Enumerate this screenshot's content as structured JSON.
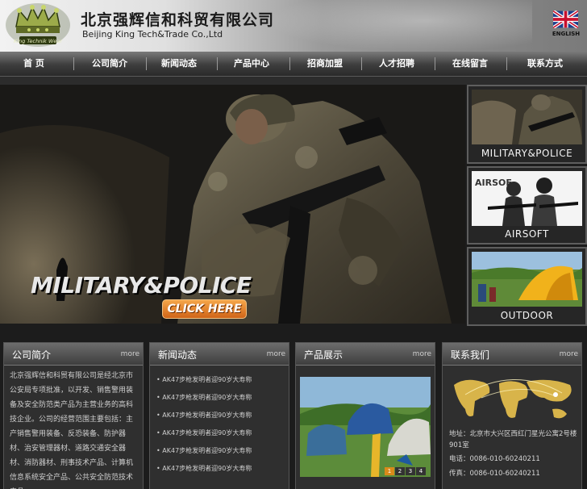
{
  "header": {
    "company_cn": "北京强辉信和科贸有限公司",
    "company_en": "Beijing King Tech&Trade Co.,Ltd",
    "logo_text": "King Technik Wear",
    "english_label": "ENGLISH"
  },
  "nav": {
    "items": [
      "首 页",
      "公司简介",
      "新闻动态",
      "产品中心",
      "招商加盟",
      "人才招聘",
      "在线留言",
      "联系方式"
    ]
  },
  "banner": {
    "title": "MILITARY&POLICE",
    "button": "CLICK HERE"
  },
  "side_thumbs": [
    {
      "label": "MILITARY&POLICE"
    },
    {
      "label": "AIRSOFT",
      "logo_text": "AIRSOF"
    },
    {
      "label": "OUTDOOR"
    }
  ],
  "about": {
    "title": "公司简介",
    "more": "more",
    "text": "北京强辉信和科贸有限公司是经北京市公安局专项批准，以开发、销售警用装备及安全防范类产品为主营业务的高科技企业。公司的经营范围主要包括：主产销售警用装备、反恐装备、防护器材、治安管理器材、道路交通安全器材、消防器材、刑事技术产品、计算机信息系统安全产品、公共安全防范技术产品。。。"
  },
  "news": {
    "title": "新闻动态",
    "more": "more",
    "items": [
      "• AK47步枪发明者迎90岁大寿称",
      "• AK47步枪发明者迎90岁大寿称",
      "• AK47步枪发明者迎90岁大寿称",
      "• AK47步枪发明者迎90岁大寿称",
      "• AK47步枪发明者迎90岁大寿称",
      "• AK47步枪发明者迎90岁大寿称"
    ]
  },
  "products": {
    "title": "产品展示",
    "more": "more",
    "pager": [
      "1",
      "2",
      "3",
      "4"
    ]
  },
  "contact": {
    "title": "联系我们",
    "more": "more",
    "address": "地址：北京市大兴区西红门星光公寓2号楼901室",
    "phone": "电话：0086-010-60240211",
    "fax": "传真：0086-010-60240211"
  },
  "colors": {
    "accent_orange": "#d06418",
    "nav_bg": "#3d3d3d",
    "panel_bg": "#2f2f2f",
    "map_gold": "#d8b44a"
  }
}
